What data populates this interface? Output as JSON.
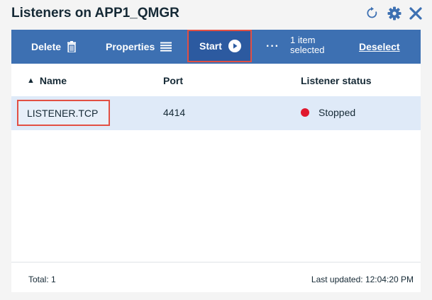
{
  "window": {
    "title": "Listeners on APP1_QMGR"
  },
  "header_icons": [
    "refresh-icon",
    "gear-icon",
    "close-icon"
  ],
  "colors": {
    "toolbar": "#3d70b2",
    "highlight": "#e24f43",
    "stopped": "#e0182d",
    "row_selected": "#dfeaf8",
    "icon": "#3d70b2"
  },
  "toolbar": {
    "delete_label": "Delete",
    "properties_label": "Properties",
    "start_label": "Start",
    "more_label": "···",
    "selected_line1": "1 item",
    "selected_line2": "selected",
    "deselect_label": "Deselect"
  },
  "table": {
    "columns": {
      "name": "Name",
      "port": "Port",
      "status": "Listener status"
    },
    "sort_indicator": "▲",
    "rows": [
      {
        "name": "LISTENER.TCP",
        "port": "4414",
        "status": "Stopped"
      }
    ]
  },
  "footer": {
    "total": "Total: 1",
    "last_updated": "Last updated: 12:04:20 PM"
  }
}
